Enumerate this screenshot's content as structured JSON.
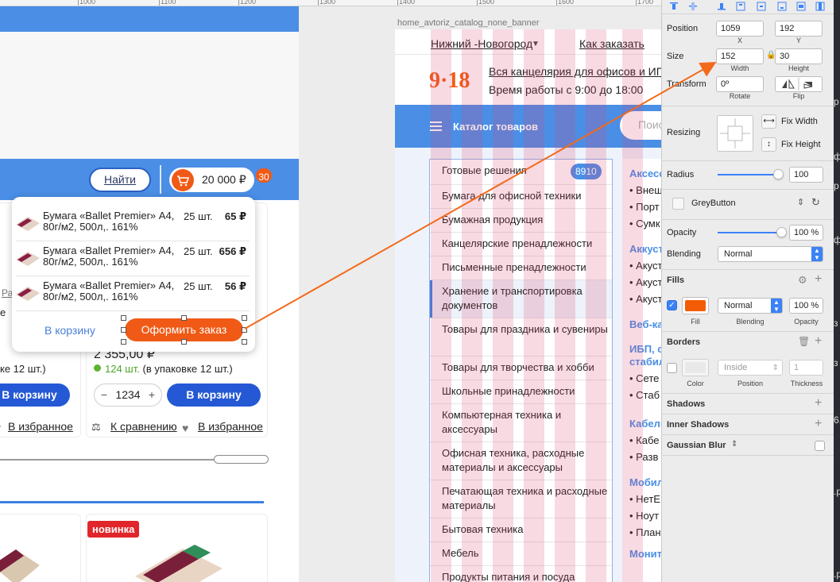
{
  "ruler": {
    "labels": [
      "1000",
      "1100",
      "1200",
      "1300",
      "1400",
      "1500",
      "1600",
      "1700"
    ]
  },
  "left_board": {
    "find_label": "Найти",
    "cart_total": "20 000 ₽",
    "cart_count": "30",
    "partial_ra": "Ра",
    "partial_a": "е",
    "price": "2 355,00 ₽",
    "stock_amount": "124 шт.",
    "stock_pack": "(в упаковке 12 шт.)",
    "pack_a": "ке 12 шт.)",
    "cart_button": "В корзину",
    "stepper_minus": "−",
    "stepper_value": "1234",
    "stepper_plus": "+",
    "compare": "К сравнению",
    "favorite": "В избранное",
    "new_badge": "новинка"
  },
  "popup": {
    "items": [
      {
        "name": "Бумага «Ballet Premier» А4, 80г/м2, 500л,. 161%",
        "qty": "25 шт.",
        "price": "65 ₽"
      },
      {
        "name": "Бумага «Ballet Premier» А4, 80г/м2, 500л,. 161%",
        "qty": "25 шт.",
        "price": "656 ₽"
      },
      {
        "name": "Бумага «Ballet Premier» А4, 80г/м2, 500л,. 161%",
        "qty": "25 шт.",
        "price": "56 ₽"
      }
    ],
    "to_cart": "В корзину",
    "order": "Оформить заказ"
  },
  "right_board": {
    "artboard_name": "home_avtoriz_catalog_none_banner",
    "city": "Нижний -Новогород",
    "how_order": "Как заказать",
    "logo": "9·18",
    "tagline": "Вся канцелярия для офисов и ИП",
    "hours": "Время работы с 9:00 до 18:00",
    "catalog": "Каталог товаров",
    "search_placeholder": "Поис",
    "badge": "8910",
    "categories": [
      "Готовые решения",
      "Бумага для офисной техники",
      "Бумажная продукция",
      "Канцелярские пренадлежности",
      "Письменные пренадлежности",
      "Хранение и транспортировка документов",
      "Товары для праздника и сувениры",
      "Товары для творчества и хобби",
      "Школьные принадлежности",
      "Компьютерная техника и аксессуары",
      "Офисная техника, расходные материалы и аксессуары",
      "Печатающая техника и расходные материалы",
      "Бытовая техника",
      "Мебель",
      "Продукты питания и посуда"
    ],
    "sub": {
      "h1": "Аксесс",
      "i1": "• Внеш",
      "i2": "• Порт",
      "i3": "• Сумк",
      "h2": "Аккуст",
      "i4": "• Акуст",
      "i5": "• Акуст",
      "i6": "• Акуст",
      "h3": "Веб-ка",
      "h4a": "ИБП, с",
      "h4b": "стабил",
      "i7": "• Сете",
      "i8": "• Стаб",
      "h5": "Кабели",
      "i9": "• Кабе",
      "i10": "• Разв",
      "h6": "Мобил",
      "i11": "• НетЕ",
      "i12": "• Ноут",
      "i13": "• План",
      "h7": "Монит"
    }
  },
  "inspector": {
    "position": {
      "label": "Position",
      "x": "1059",
      "y": "192",
      "x_cap": "X",
      "y_cap": "Y"
    },
    "size": {
      "label": "Size",
      "w": "152",
      "h": "30",
      "w_cap": "Width",
      "h_cap": "Height"
    },
    "transform": {
      "label": "Transform",
      "rotate": "0º",
      "rotate_cap": "Rotate",
      "flip_cap": "Flip"
    },
    "resizing": {
      "label": "Resizing",
      "fix_width": "Fix Width",
      "fix_height": "Fix Height"
    },
    "radius": {
      "label": "Radius",
      "value": "100",
      "level": 0.95
    },
    "style": {
      "name": "GreyButton"
    },
    "opacity": {
      "label": "Opacity",
      "value": "100 %",
      "level": 1.0
    },
    "blending": {
      "label": "Blending",
      "value": "Normal"
    },
    "fills": {
      "title": "Fills",
      "color": "#f35b04",
      "blending": "Normal",
      "opacity": "100 %",
      "fill_cap": "Fill",
      "blending_cap": "Blending",
      "opacity_cap": "Opacity"
    },
    "borders": {
      "title": "Borders",
      "position": "Inside",
      "thickness": "1",
      "color_cap": "Color",
      "position_cap": "Position",
      "thickness_cap": "Thickness"
    },
    "shadows": "Shadows",
    "inner_shadows": "Inner Shadows",
    "blur": "Gaussian Blur"
  },
  "desktop": {
    "frags": [
      "p",
      "ф",
      "p",
      "ф",
      "з",
      "з",
      "6.",
      ".p",
      ".p"
    ]
  },
  "colors": {
    "accent_orange": "#f05a16",
    "nav_blue": "#4a8ee6",
    "button_blue": "#2458d4",
    "select_blue": "#3b82f7"
  }
}
